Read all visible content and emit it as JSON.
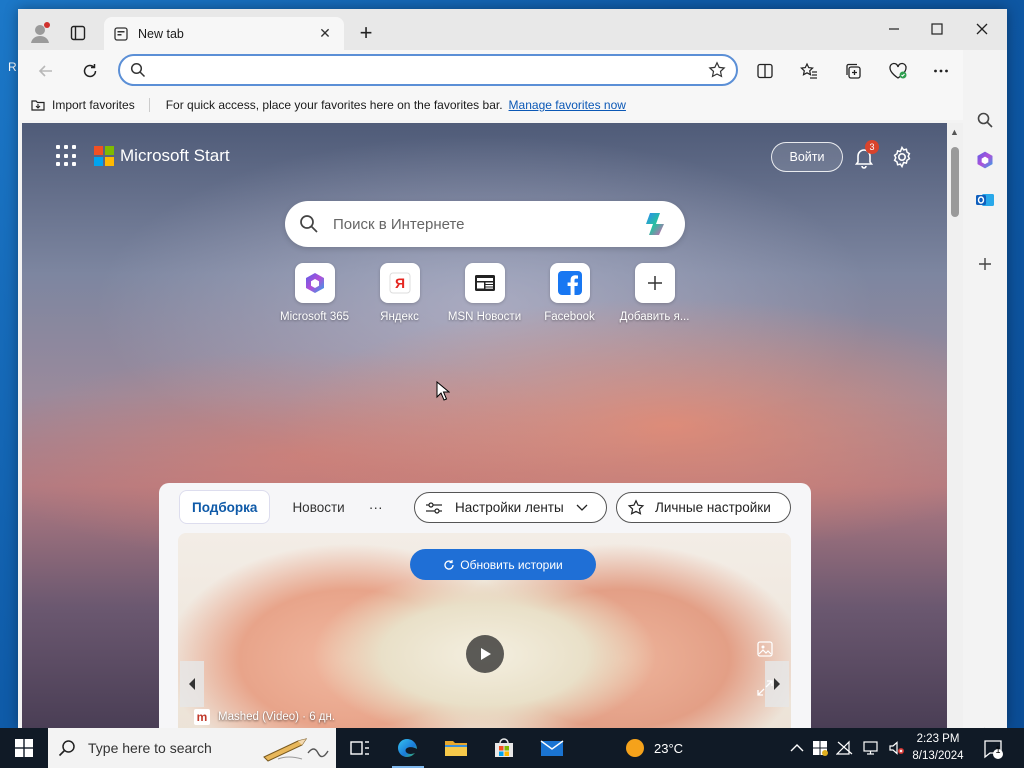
{
  "desktop": {
    "edge_text": "R"
  },
  "browser": {
    "tab_title": "New tab",
    "address_value": "",
    "favorites_bar": {
      "import_label": "Import favorites",
      "message": "For quick access, place your favorites here on the favorites bar.",
      "manage_link": "Manage favorites now"
    }
  },
  "newtab": {
    "brand": "Microsoft Start",
    "signin_label": "Войти",
    "notification_count": "3",
    "search_placeholder": "Поиск в Интернете",
    "quicklinks": [
      {
        "label": "Microsoft 365",
        "icon": "m365-icon"
      },
      {
        "label": "Яндекс",
        "icon": "yandex-icon"
      },
      {
        "label": "MSN Новости",
        "icon": "msn-news-icon"
      },
      {
        "label": "Facebook",
        "icon": "facebook-icon"
      },
      {
        "label": "Добавить я...",
        "icon": "plus-icon"
      }
    ],
    "feed": {
      "tabs": [
        "Подборка",
        "Новости"
      ],
      "more": "···",
      "feed_settings": "Настройки ленты",
      "personal_settings": "Личные настройки",
      "refresh": "Обновить истории",
      "source_logo": "m",
      "source": "Mashed (Video) · 6 дн."
    }
  },
  "taskbar": {
    "search_placeholder": "Type here to search",
    "weather": "23°C",
    "time": "2:23 PM",
    "date": "8/13/2024",
    "notification_count": "1"
  },
  "colors": {
    "accent": "#1f6fd6",
    "taskbar": "#101a26",
    "link": "#0b58b6"
  }
}
